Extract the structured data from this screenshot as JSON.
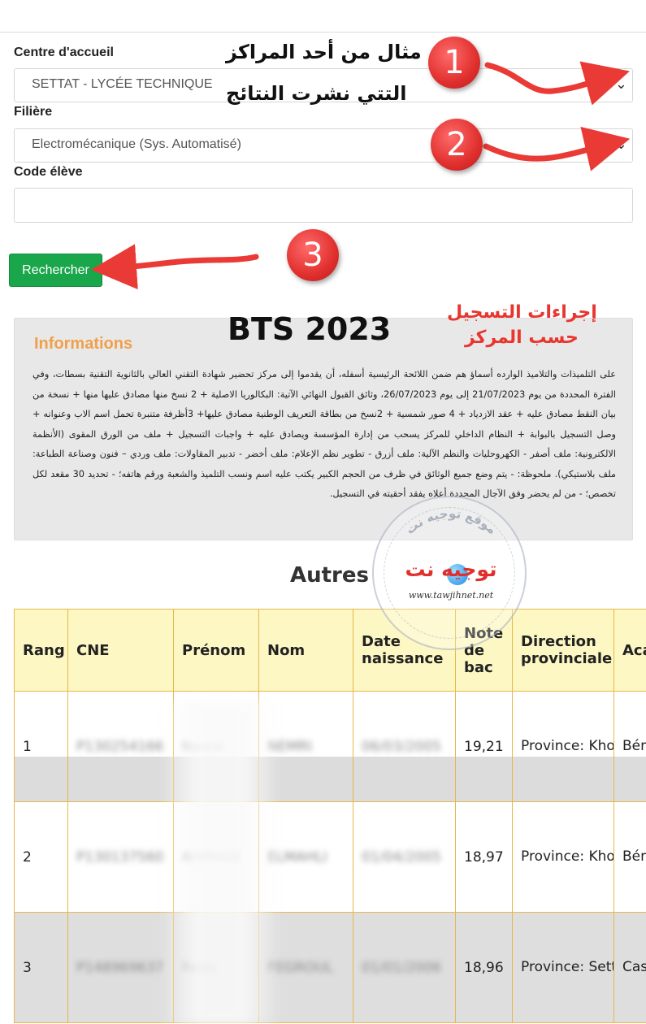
{
  "form": {
    "centre_label": "Centre d'accueil",
    "centre_value": "SETTAT - LYCÉE TECHNIQUE",
    "filiere_label": "Filière",
    "filiere_value": "Electromécanique (Sys. Automatisé)",
    "code_label": "Code élève",
    "code_value": "",
    "search_button": "Rechercher"
  },
  "annotations": {
    "example_line1": "مثال من أحد المراكز",
    "example_line2": "التتي نشرت النتائج",
    "badge1": "1",
    "badge2": "2",
    "badge3": "3",
    "procedures_line1": "إجراءات التسجيل",
    "procedures_line2": "حسب المركز",
    "bts_title": "BTS 2023"
  },
  "info": {
    "title": "Informations",
    "text": "على التلميذات والتلاميذ الوارده أسماؤ هم ضمن اللائحة الرئيسية أسفله، أن يقدموا إلى مركز تحضير شهادة التقني العالي بالثانوية التقنية بسطات، وفي الفترة المحددة من يوم 21/07/2023 إلى يوم 26/07/2023، وثائق القبول النهائي الآتية: البكالوريا الاصلية + 2 نسخ منها مصادق عليها منها + نسخة من بيان النقط مصادق عليه + عقد الازدياد + 4 صور شمسية + 2نسخ من بطاقة التعريف الوطنية مصادق عليها+ 3أظرفة متنبرة تحمل اسم الاب وعنوانه + وصل التسجيل بالبوابة + النظام الداخلي للمركز يسحب من إدارة المؤسسة ويصادق عليه + واجبات التسجيل + ملف من الورق المقوى (الأنظمة الالكترونية: ملف أصفر - الكهروحليات والنظم الآلية: ملف أزرق - تطوير نظم الإعلام: ملف أخضر - تدبير المقاولات: ملف وردي – فنون وصناعة الطباعة: ملف بلاستيكي). ملحوظة: - يتم وضع جميع الوثائق في ظرف من الحجم الكبير يكتب عليه اسم ونسب التلميذ والشعبة ورقم هاتفه؛ - تحديد 30 مقعد لكل تخصص؛ - من لم يحضر وفق الآجال المحددة أعلاه يفقد أحقيته في التسجيل."
  },
  "watermark": {
    "logo_text": "توجيه نت",
    "ring_text": "موقع توجيه نت",
    "url": "www.tawjihnet.net"
  },
  "results": {
    "heading": "Autres",
    "columns": [
      "Rang",
      "CNE",
      "Prénom",
      "Nom",
      "Date naissance",
      "Note de bac",
      "Direction provinciale",
      "Aca"
    ],
    "rows": [
      {
        "rang": "1",
        "cne": "P130254166",
        "prenom": "Nawal",
        "nom": "NEMRI",
        "date": "06/03/2005",
        "note": "19,21",
        "direction": "Province: Khouribga",
        "aca": "Bén Khé"
      },
      {
        "rang": "2",
        "cne": "P130137560",
        "prenom": "AHMADE",
        "nom": "ELMAHLI",
        "date": "01/04/2005",
        "note": "18,97",
        "direction": "Province: Khouribga",
        "aca": "Bén Khé"
      },
      {
        "rang": "3",
        "cne": "P148969637",
        "prenom": "Reda",
        "nom": "FEGROUL",
        "date": "01/01/2006",
        "note": "18,96",
        "direction": "Province: Settat",
        "aca": "Cas Set"
      }
    ]
  },
  "colors": {
    "accent_green": "#1aa64b",
    "info_title": "#f0a04b",
    "annotation_red": "#e8362f",
    "table_header": "#fdf7c3",
    "table_border": "#e7b84a"
  }
}
